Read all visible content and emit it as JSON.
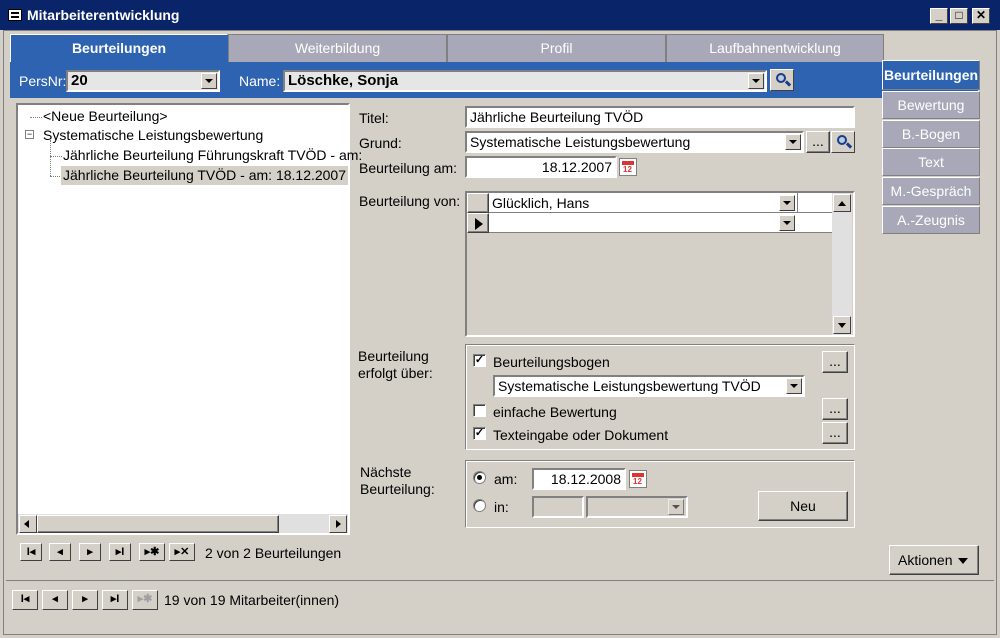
{
  "window": {
    "title": "Mitarbeiterentwicklung"
  },
  "tabs": [
    "Beurteilungen",
    "Weiterbildung",
    "Profil",
    "Laufbahnentwicklung"
  ],
  "header": {
    "persnr_label": "PersNr:",
    "persnr_value": "20",
    "name_label": "Name:",
    "name_value": "Löschke, Sonja"
  },
  "side_tabs": [
    "Beurteilungen",
    "Bewertung",
    "B.-Bogen",
    "Text",
    "M.-Gespräch",
    "A.-Zeugnis"
  ],
  "tree": {
    "items": [
      "<Neue Beurteilung>",
      "Systematische Leistungsbewertung",
      "Jährliche Beurteilung Führungskraft TVÖD - am:",
      "Jährliche Beurteilung TVÖD - am: 18.12.2007"
    ]
  },
  "tree_nav": {
    "status": "2 von 2 Beurteilungen"
  },
  "form": {
    "titel_label": "Titel:",
    "titel_value": "Jährliche Beurteilung TVÖD",
    "grund_label": "Grund:",
    "grund_value": "Systematische Leistungsbewertung",
    "am_label": "Beurteilung am:",
    "am_value": "18.12.2007",
    "von_label": "Beurteilung von:",
    "von_rows": [
      "Glücklich, Hans",
      ""
    ],
    "erfolgt_label_1": "Beurteilung",
    "erfolgt_label_2": "erfolgt über:",
    "bogen_label": "Beurteilungsbogen",
    "bogen_checked": true,
    "bogen_select": "Systematische Leistungsbewertung TVÖD",
    "einfach_label": "einfache Bewertung",
    "einfach_checked": false,
    "text_label": "Texteingabe oder Dokument",
    "text_checked": true,
    "naechste_label_1": "Nächste",
    "naechste_label_2": "Beurteilung:",
    "am_radio_label": "am:",
    "naechste_date": "18.12.2008",
    "in_radio_label": "in:",
    "neu_button": "Neu",
    "dots": "..."
  },
  "aktionen_button": "Aktionen",
  "bottom_nav": {
    "status": "19 von 19 Mitarbeiter(innen)"
  }
}
